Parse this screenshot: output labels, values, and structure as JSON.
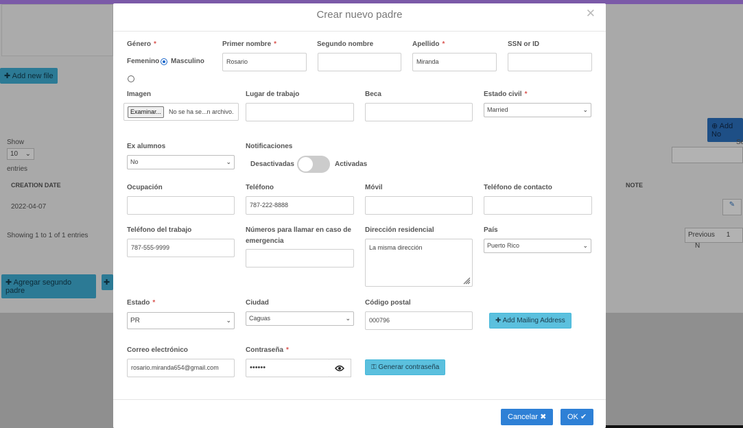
{
  "background": {
    "add_new_file": "Add new file",
    "show_label": "Show",
    "show_value": "10",
    "entries_label": "entries",
    "col_creation_date": "CREATION DATE",
    "col_note": "NOTE",
    "row_date": "2022-04-07",
    "showing_text": "Showing 1 to 1 of 1 entries",
    "add_second_parent": "Agregar segundo padre",
    "add_new_partial": "Add No",
    "search_partial": "Se",
    "previous": "Previous",
    "page_1": "1",
    "page_next_partial": "N"
  },
  "modal": {
    "title": "Crear nuevo padre",
    "fields": {
      "genero_label": "Género",
      "femenino": "Femenino",
      "masculino": "Masculino",
      "primer_nombre_label": "Primer nombre",
      "primer_nombre_value": "Rosario",
      "segundo_nombre_label": "Segundo nombre",
      "segundo_nombre_value": "",
      "apellido_label": "Apellido",
      "apellido_value": "Miranda",
      "ssn_label": "SSN or ID",
      "ssn_value": "",
      "imagen_label": "Imagen",
      "file_button": "Examinar...",
      "file_status": "No se ha se...n archivo.",
      "lugar_trabajo_label": "Lugar de trabajo",
      "beca_label": "Beca",
      "estado_civil_label": "Estado civil",
      "estado_civil_value": "Married",
      "ex_alumnos_label": "Ex alumnos",
      "ex_alumnos_value": "No",
      "notificaciones_label": "Notificaciones",
      "desactivadas": "Desactivadas",
      "activadas": "Activadas",
      "ocupacion_label": "Ocupación",
      "telefono_label": "Teléfono",
      "telefono_value": "787-222-8888",
      "movil_label": "Móvil",
      "telefono_contacto_label": "Teléfono de contacto",
      "telefono_trabajo_label": "Teléfono del trabajo",
      "telefono_trabajo_value": "787-555-9999",
      "emergencia_label_1": "Números para llamar en caso de",
      "emergencia_label_2": "emergencia",
      "direccion_label": "Dirección residencial",
      "direccion_value": "La misma dirección",
      "pais_label": "País",
      "pais_value": "Puerto Rico",
      "estado_label": "Estado",
      "estado_value": "PR",
      "ciudad_label": "Ciudad",
      "ciudad_value": "Caguas",
      "codigo_postal_label": "Código postal",
      "codigo_postal_value": "000796",
      "add_mailing": "Add Mailing Address",
      "correo_label": "Correo electrónico",
      "correo_value": "rosario.miranda654@gmail.com",
      "contrasena_label": "Contraseña",
      "contrasena_value": "••••••",
      "generar": "Generar contraseña"
    },
    "buttons": {
      "cancel": "Cancelar",
      "ok": "OK"
    },
    "required_mark": "*"
  },
  "colors": {
    "primary": "#2e80d6",
    "info": "#5bc0de",
    "required": "#d9534f"
  }
}
